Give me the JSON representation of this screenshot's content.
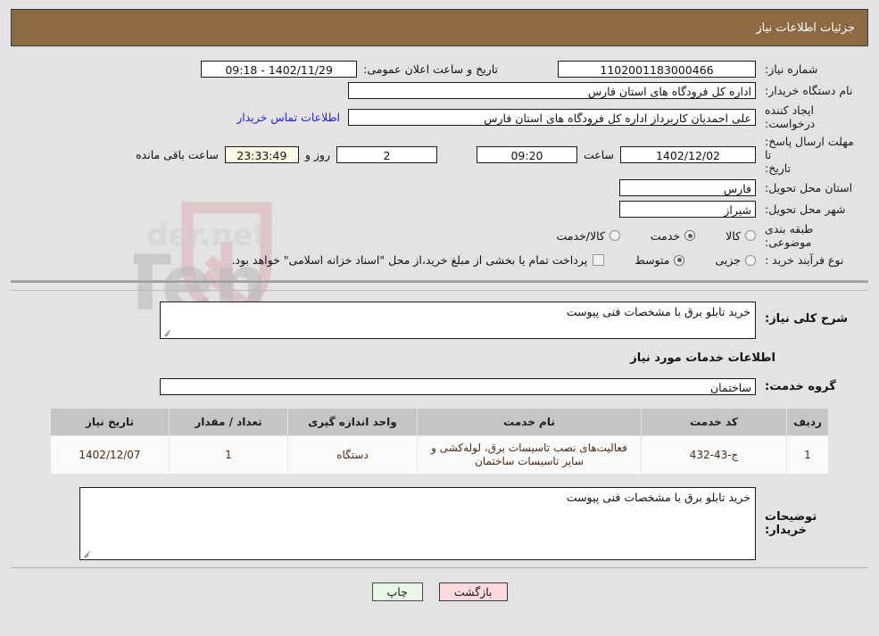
{
  "header": {
    "title": "جزئیات اطلاعات نیاز"
  },
  "top_form": {
    "need_number_label": "شماره نیاز:",
    "need_number_value": "1102001183000466",
    "announce_label": "تاریخ و ساعت اعلان عمومی:",
    "announce_value": "1402/11/29 - 09:18",
    "buyer_org_label": "نام دستگاه خریدار:",
    "buyer_org_value": "اداره کل فرودگاه های استان فارس",
    "creator_label": "ایجاد کننده درخواست:",
    "creator_value": "علی  احمدیان کاربرداز اداره کل فرودگاه های استان فارس",
    "contact_link": "اطلاعات تماس خریدار",
    "deadline_label_line1": "مهلت ارسال پاسخ: تا",
    "deadline_label_line2": "تاریخ:",
    "deadline_date": "1402/12/02",
    "hour_label": "ساعت",
    "hour_value": "09:20",
    "days_value": "2",
    "days_label": "روز و",
    "countdown_value": "23:33:49",
    "countdown_label": "ساعت باقی مانده",
    "province_label": "استان محل تحویل:",
    "province_value": "فارس",
    "city_label": "شهر محل تحویل:",
    "city_value": "شیراز",
    "category_label": "طبقه بندی موضوعی:",
    "category_options": [
      {
        "label": "کالا",
        "selected": false
      },
      {
        "label": "خدمت",
        "selected": true
      },
      {
        "label": "کالا/خدمت",
        "selected": false
      }
    ],
    "process_label": "نوع فرآیند خرید :",
    "process_options": [
      {
        "label": "جزیی",
        "selected": false
      },
      {
        "label": "متوسط",
        "selected": true
      }
    ],
    "treasury_checkbox_label": "پرداخت تمام یا بخشی از مبلغ خرید،از محل \"اسناد خزانه اسلامی\" خواهد بود.",
    "treasury_checked": false
  },
  "mid": {
    "general_desc_label": "شرح کلی نیاز:",
    "general_desc_value": "خرید تابلو برق با مشخصات فنی پیوست",
    "services_section_title": "اطلاعات خدمات مورد نیاز",
    "service_group_label": "گروه خدمت:",
    "service_group_value": "ساختمان"
  },
  "table": {
    "columns": [
      "ردیف",
      "کد خدمت",
      "نام خدمت",
      "واحد اندازه گیری",
      "تعداد / مقدار",
      "تاریخ نیاز"
    ],
    "rows": [
      {
        "radif": "1",
        "code": "ج-43-432",
        "name": "فعالیت‌های نصب تاسیسات برق، لوله‌کشی و سایر تاسیسات ساختمان",
        "unit": "دستگاه",
        "qty": "1",
        "date": "1402/12/07"
      }
    ]
  },
  "bottom": {
    "buyer_notes_label": "توضیحات خریدار:",
    "buyer_notes_value": "خرید تابلو برق با مشخصات فنی پیوست",
    "print_button": "چاپ",
    "back_button": "بازگشت"
  },
  "watermark": {
    "text": "AriaTender.net"
  },
  "colors": {
    "title_bar": "#8d6a43",
    "page_bg": "#e3e3e3",
    "link": "#2222dd",
    "countdown_bg": "#fbfae4",
    "table_header_bg": "#c5c5c5",
    "table_text": "#4a2c14",
    "print_bg": "#e8f6e8",
    "back_bg": "#fadadd"
  }
}
